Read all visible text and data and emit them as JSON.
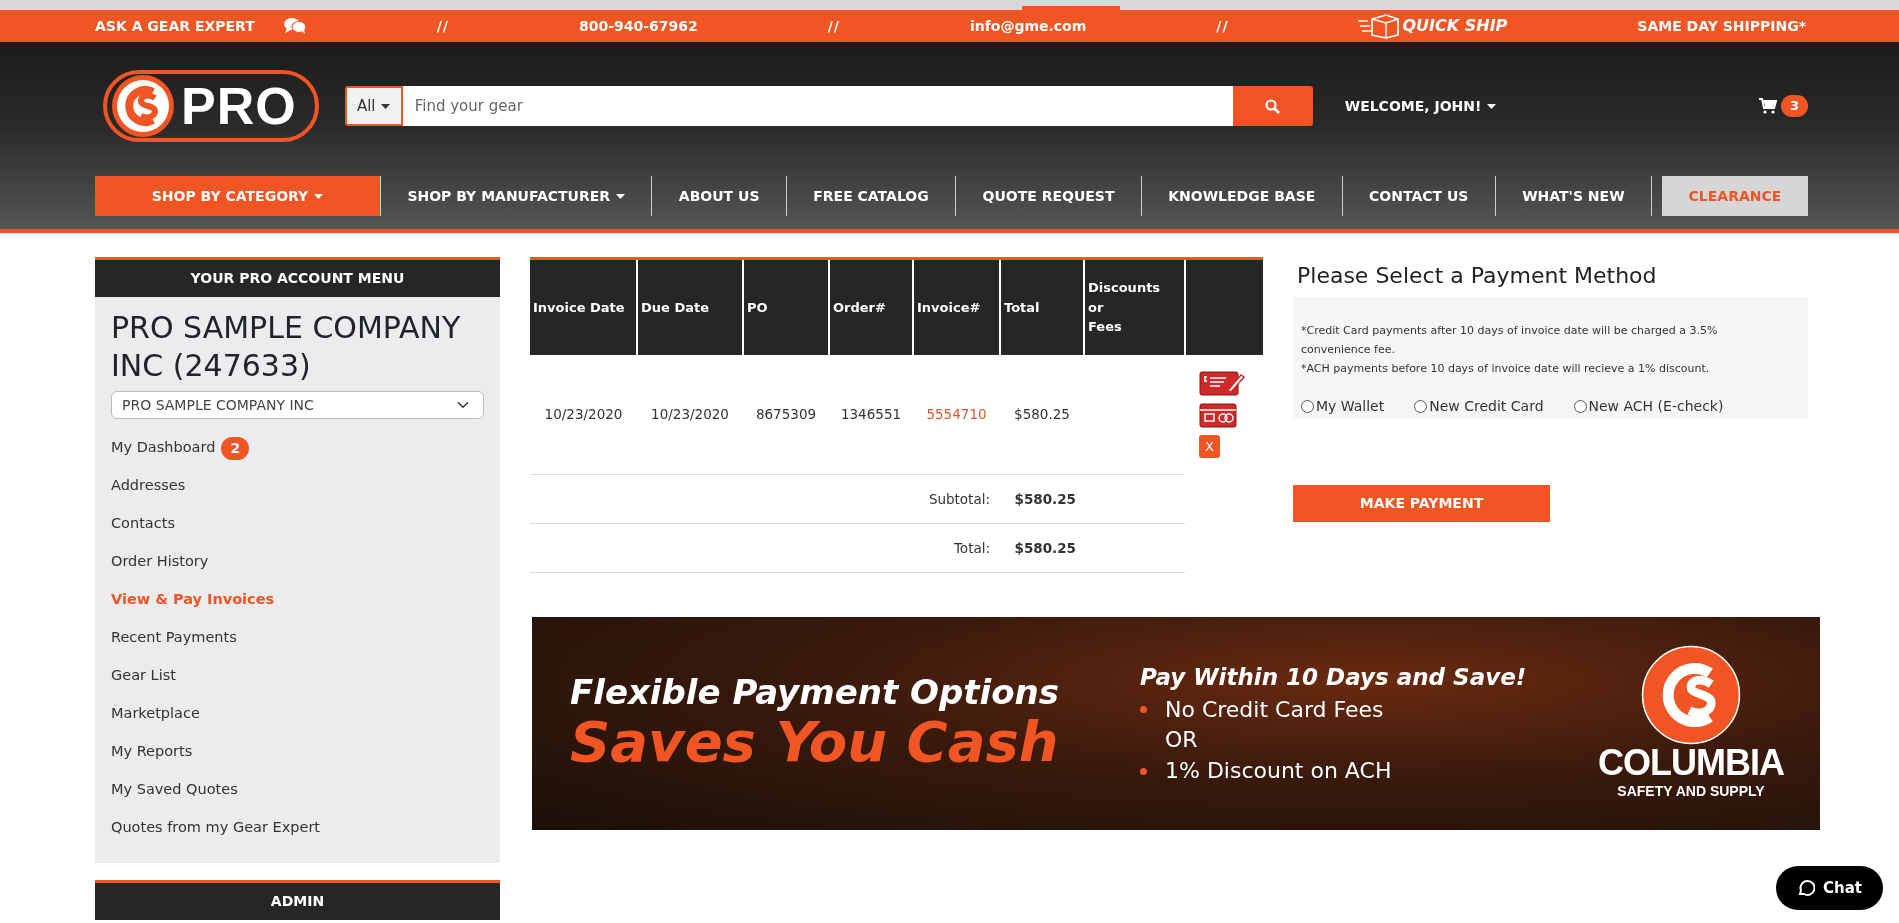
{
  "top_bar": {
    "items": [
      {
        "kind": "expert",
        "text": "ASK A GEAR EXPERT"
      },
      {
        "kind": "separator",
        "text": "//"
      },
      {
        "kind": "text",
        "text": "800-940-67962"
      },
      {
        "kind": "separator",
        "text": "//"
      },
      {
        "kind": "text",
        "text": "info@gme.com"
      },
      {
        "kind": "separator",
        "text": "//"
      },
      {
        "kind": "quickship",
        "text": "QUICK SHIP"
      },
      {
        "kind": "text",
        "text": "SAME DAY SHIPPING*"
      }
    ]
  },
  "header": {
    "logo_text": "PRO",
    "search": {
      "category": "All",
      "placeholder": "Find your gear"
    },
    "welcome": "WELCOME, JOHN!",
    "cart_count": "3"
  },
  "nav": [
    {
      "label": "SHOP BY CATEGORY",
      "dropdown": true,
      "kind": "primary"
    },
    {
      "label": "SHOP BY MANUFACTURER",
      "dropdown": true,
      "kind": "link"
    },
    {
      "label": "ABOUT US",
      "dropdown": false,
      "kind": "link"
    },
    {
      "label": "FREE CATALOG",
      "dropdown": false,
      "kind": "link"
    },
    {
      "label": "QUOTE REQUEST",
      "dropdown": false,
      "kind": "link"
    },
    {
      "label": "KNOWLEDGE BASE",
      "dropdown": false,
      "kind": "link"
    },
    {
      "label": "CONTACT US",
      "dropdown": false,
      "kind": "link"
    },
    {
      "label": "WHAT'S NEW",
      "dropdown": false,
      "kind": "link"
    },
    {
      "label": "CLEARANCE",
      "dropdown": false,
      "kind": "clearance"
    }
  ],
  "sidebar": {
    "title": "YOUR PRO ACCOUNT MENU",
    "company": "PRO SAMPLE COMPANY INC (247633)",
    "company_select": "PRO SAMPLE COMPANY INC",
    "items": [
      {
        "label": "My Dashboard",
        "badge": "2",
        "selected": false
      },
      {
        "label": "Addresses",
        "selected": false
      },
      {
        "label": "Contacts",
        "selected": false
      },
      {
        "label": "Order History",
        "selected": false
      },
      {
        "label": "View & Pay Invoices",
        "selected": true
      },
      {
        "label": "Recent Payments",
        "selected": false
      },
      {
        "label": "Gear List",
        "selected": false
      },
      {
        "label": "Marketplace",
        "selected": false
      },
      {
        "label": "My Reports",
        "selected": false
      },
      {
        "label": "My Saved Quotes",
        "selected": false
      },
      {
        "label": "Quotes from my Gear Expert",
        "selected": false
      }
    ],
    "admin_title": "ADMIN"
  },
  "table": {
    "columns": [
      "Invoice Date",
      "Due Date",
      "PO",
      "Order#",
      "Invoice#",
      "Total",
      "Discounts or Fees"
    ],
    "rows": [
      {
        "invoice_date": "10/23/2020",
        "due_date": "10/23/2020",
        "po": "8675309",
        "order": "1346551",
        "invoice": "5554710",
        "total": "$580.25",
        "remove_label": "X"
      }
    ],
    "subtotal_label": "Subtotal:",
    "subtotal": "$580.25",
    "total_label": "Total:",
    "total": "$580.25"
  },
  "payment": {
    "title": "Please Select a Payment Method",
    "notes": [
      "*Credit Card payments after 10 days of invoice date will be charged a 3.5% convenience fee.",
      "*ACH payments before 10 days of invoice date will recieve a 1% discount."
    ],
    "options": [
      {
        "label": "My Wallet",
        "selected": false
      },
      {
        "label": "New Credit Card",
        "selected": false
      },
      {
        "label": "New ACH (E-check)",
        "selected": false
      }
    ],
    "button": "MAKE PAYMENT"
  },
  "banner": {
    "headline": "Flexible Payment Options",
    "slogan": "Saves You Cash",
    "offer_title": "Pay Within 10 Days and Save!",
    "offer_lines": [
      {
        "kind": "bullet",
        "text": "No Credit Card Fees"
      },
      {
        "kind": "plain",
        "text": "OR"
      },
      {
        "kind": "bullet",
        "text": "1% Discount on ACH"
      }
    ],
    "brand": "COLUMBIA",
    "brand_sub": "SAFETY AND SUPPLY"
  },
  "chat": {
    "label": "Chat"
  }
}
